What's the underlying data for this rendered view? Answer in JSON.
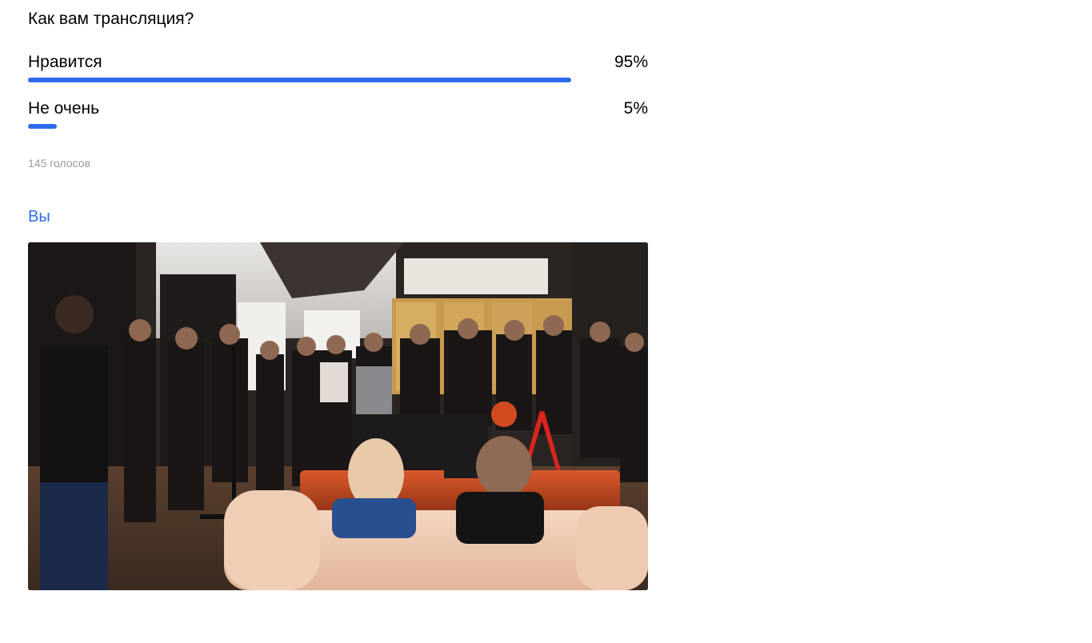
{
  "poll": {
    "question": "Как вам трансляция?",
    "options": [
      {
        "label": "Нравится",
        "percent_text": "95%",
        "fraction": 0.95
      },
      {
        "label": "Не очень",
        "percent_text": "5%",
        "fraction": 0.05
      }
    ],
    "votes_text": "145 голосов"
  },
  "post": {
    "author_label": "Вы",
    "image_icon": "photo-of-audience-at-event-icon"
  },
  "colors": {
    "accent": "#2f6bed",
    "muted_text": "#9a9a9a"
  }
}
